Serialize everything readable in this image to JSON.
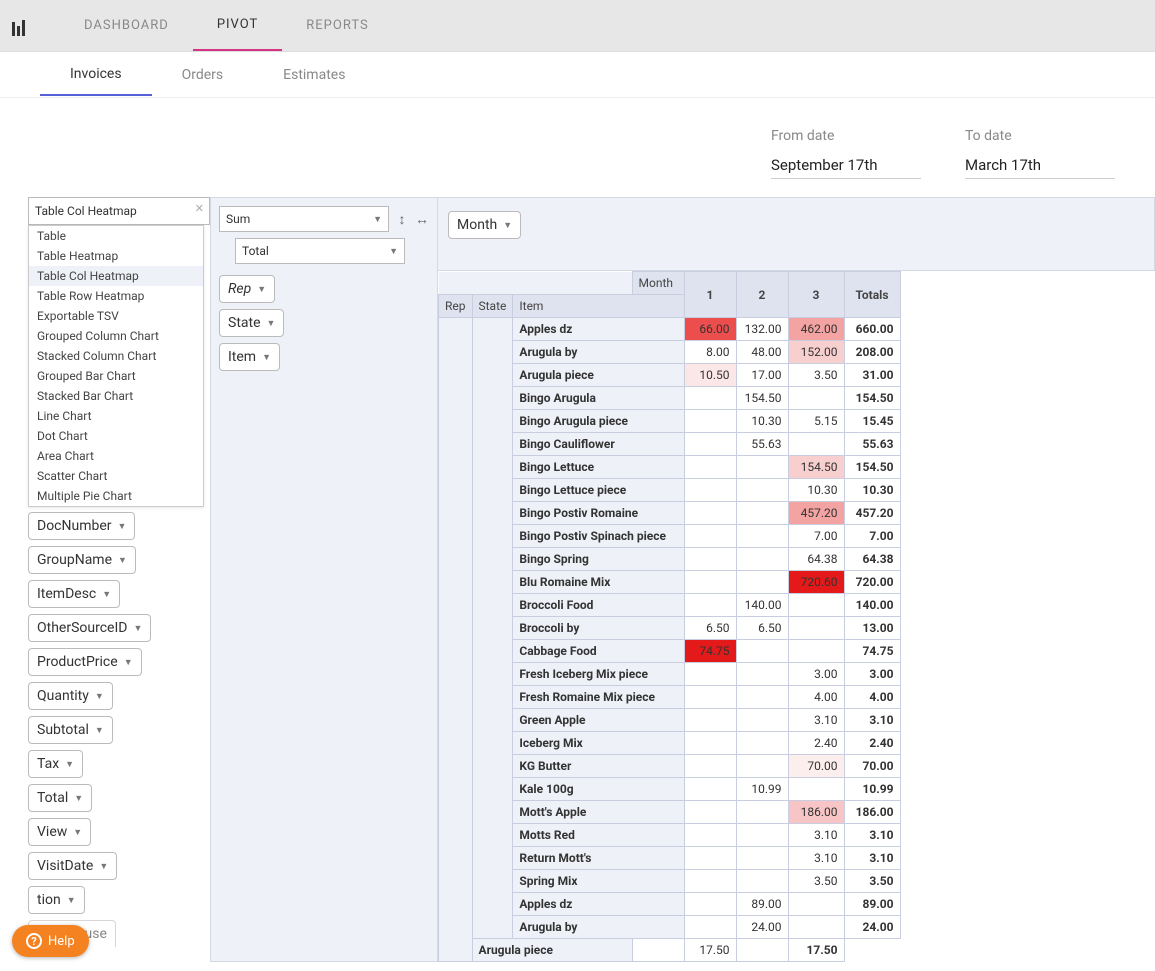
{
  "topnav": {
    "dashboard": "DASHBOARD",
    "pivot": "PIVOT",
    "reports": "REPORTS"
  },
  "subnav": {
    "invoices": "Invoices",
    "orders": "Orders",
    "estimates": "Estimates"
  },
  "dates": {
    "from_label": "From date",
    "from_value": "September 17th",
    "to_label": "To date",
    "to_value": "March 17th"
  },
  "renderer": {
    "selected": "Table Col Heatmap",
    "options": [
      "Table",
      "Table Heatmap",
      "Table Col Heatmap",
      "Table Row Heatmap",
      "Exportable TSV",
      "Grouped Column Chart",
      "Stacked Column Chart",
      "Grouped Bar Chart",
      "Stacked Bar Chart",
      "Line Chart",
      "Dot Chart",
      "Area Chart",
      "Scatter Chart",
      "Multiple Pie Chart"
    ]
  },
  "aggregator": {
    "fn": "Sum",
    "attr": "Total"
  },
  "row_attrs": [
    "Rep",
    "State",
    "Item"
  ],
  "col_attrs": [
    "Month"
  ],
  "unused_attrs": [
    "DocNumber",
    "GroupName",
    "ItemDesc",
    "OtherSourceID",
    "ProductPrice",
    "Quantity",
    "Subtotal",
    "Tax",
    "Total",
    "View",
    "VisitDate"
  ],
  "partial_attr_suffix": "tion",
  "partial_attr2": "Warehouse",
  "pivot": {
    "col_header": "Month",
    "row_headers": [
      "Rep",
      "State",
      "Item"
    ],
    "months": [
      "1",
      "2",
      "3"
    ],
    "totals_label": "Totals",
    "rows": [
      {
        "item": "Apples dz",
        "v": [
          "66.00",
          "132.00",
          "462.00"
        ],
        "t": "660.00",
        "h": [
          "#ec4d4d",
          "",
          "#f4a3a3"
        ]
      },
      {
        "item": "Arugula by",
        "v": [
          "8.00",
          "48.00",
          "152.00"
        ],
        "t": "208.00",
        "h": [
          "",
          "",
          "#f8cfcf"
        ]
      },
      {
        "item": "Arugula piece",
        "v": [
          "10.50",
          "17.00",
          "3.50"
        ],
        "t": "31.00",
        "h": [
          "#fce7e7",
          "",
          ""
        ]
      },
      {
        "item": "Bingo Arugula",
        "v": [
          "",
          "154.50",
          ""
        ],
        "t": "154.50",
        "h": [
          "",
          "",
          ""
        ]
      },
      {
        "item": "Bingo Arugula piece",
        "v": [
          "",
          "10.30",
          "5.15"
        ],
        "t": "15.45",
        "h": [
          "",
          "",
          ""
        ]
      },
      {
        "item": "Bingo Cauliflower",
        "v": [
          "",
          "55.63",
          ""
        ],
        "t": "55.63",
        "h": [
          "",
          "",
          ""
        ]
      },
      {
        "item": "Bingo Lettuce",
        "v": [
          "",
          "",
          "154.50"
        ],
        "t": "154.50",
        "h": [
          "",
          "",
          "#f8cfcf"
        ]
      },
      {
        "item": "Bingo Lettuce piece",
        "v": [
          "",
          "",
          "10.30"
        ],
        "t": "10.30",
        "h": [
          "",
          "",
          ""
        ]
      },
      {
        "item": "Bingo Postiv Romaine",
        "v": [
          "",
          "",
          "457.20"
        ],
        "t": "457.20",
        "h": [
          "",
          "",
          "#f4a3a3"
        ]
      },
      {
        "item": "Bingo Postiv Spinach piece",
        "v": [
          "",
          "",
          "7.00"
        ],
        "t": "7.00",
        "h": [
          "",
          "",
          ""
        ]
      },
      {
        "item": "Bingo Spring",
        "v": [
          "",
          "",
          "64.38"
        ],
        "t": "64.38",
        "h": [
          "",
          "",
          ""
        ]
      },
      {
        "item": "Blu Romaine Mix",
        "v": [
          "",
          "",
          "720.60"
        ],
        "t": "720.00",
        "h": [
          "",
          "",
          "#e41919"
        ]
      },
      {
        "item": "Broccoli Food",
        "v": [
          "",
          "140.00",
          ""
        ],
        "t": "140.00",
        "h": [
          "",
          "",
          ""
        ]
      },
      {
        "item": "Broccoli by",
        "v": [
          "6.50",
          "6.50",
          ""
        ],
        "t": "13.00",
        "h": [
          "",
          "",
          ""
        ]
      },
      {
        "item": "Cabbage Food",
        "v": [
          "74.75",
          "",
          ""
        ],
        "t": "74.75",
        "h": [
          "#e41919",
          "",
          ""
        ]
      },
      {
        "item": "Fresh Iceberg Mix piece",
        "v": [
          "",
          "",
          "3.00"
        ],
        "t": "3.00",
        "h": [
          "",
          "",
          ""
        ]
      },
      {
        "item": "Fresh Romaine Mix piece",
        "v": [
          "",
          "",
          "4.00"
        ],
        "t": "4.00",
        "h": [
          "",
          "",
          ""
        ]
      },
      {
        "item": "Green Apple",
        "v": [
          "",
          "",
          "3.10"
        ],
        "t": "3.10",
        "h": [
          "",
          "",
          ""
        ]
      },
      {
        "item": "Iceberg Mix",
        "v": [
          "",
          "",
          "2.40"
        ],
        "t": "2.40",
        "h": [
          "",
          "",
          ""
        ]
      },
      {
        "item": "KG Butter",
        "v": [
          "",
          "",
          "70.00"
        ],
        "t": "70.00",
        "h": [
          "",
          "",
          "#fdeeee"
        ]
      },
      {
        "item": "Kale 100g",
        "v": [
          "",
          "10.99",
          ""
        ],
        "t": "10.99",
        "h": [
          "",
          "",
          ""
        ]
      },
      {
        "item": "Mott's Apple",
        "v": [
          "",
          "",
          "186.00"
        ],
        "t": "186.00",
        "h": [
          "",
          "",
          "#f7c5c5"
        ]
      },
      {
        "item": "Motts Red",
        "v": [
          "",
          "",
          "3.10"
        ],
        "t": "3.10",
        "h": [
          "",
          "",
          ""
        ]
      },
      {
        "item": "Return Mott's",
        "v": [
          "",
          "",
          "3.10"
        ],
        "t": "3.10",
        "h": [
          "",
          "",
          ""
        ]
      },
      {
        "item": "Spring Mix",
        "v": [
          "",
          "",
          "3.50"
        ],
        "t": "3.50",
        "h": [
          "",
          "",
          ""
        ]
      },
      {
        "item": "Apples dz",
        "v": [
          "",
          "89.00",
          ""
        ],
        "t": "89.00",
        "h": [
          "",
          "",
          ""
        ],
        "newgroup": true
      },
      {
        "item": "Arugula by",
        "v": [
          "",
          "24.00",
          ""
        ],
        "t": "24.00",
        "h": [
          "",
          "",
          ""
        ]
      },
      {
        "item": "Arugula piece",
        "v": [
          "",
          "17.50",
          ""
        ],
        "t": "17.50",
        "h": [
          "",
          "",
          ""
        ]
      }
    ]
  },
  "help": "Help"
}
